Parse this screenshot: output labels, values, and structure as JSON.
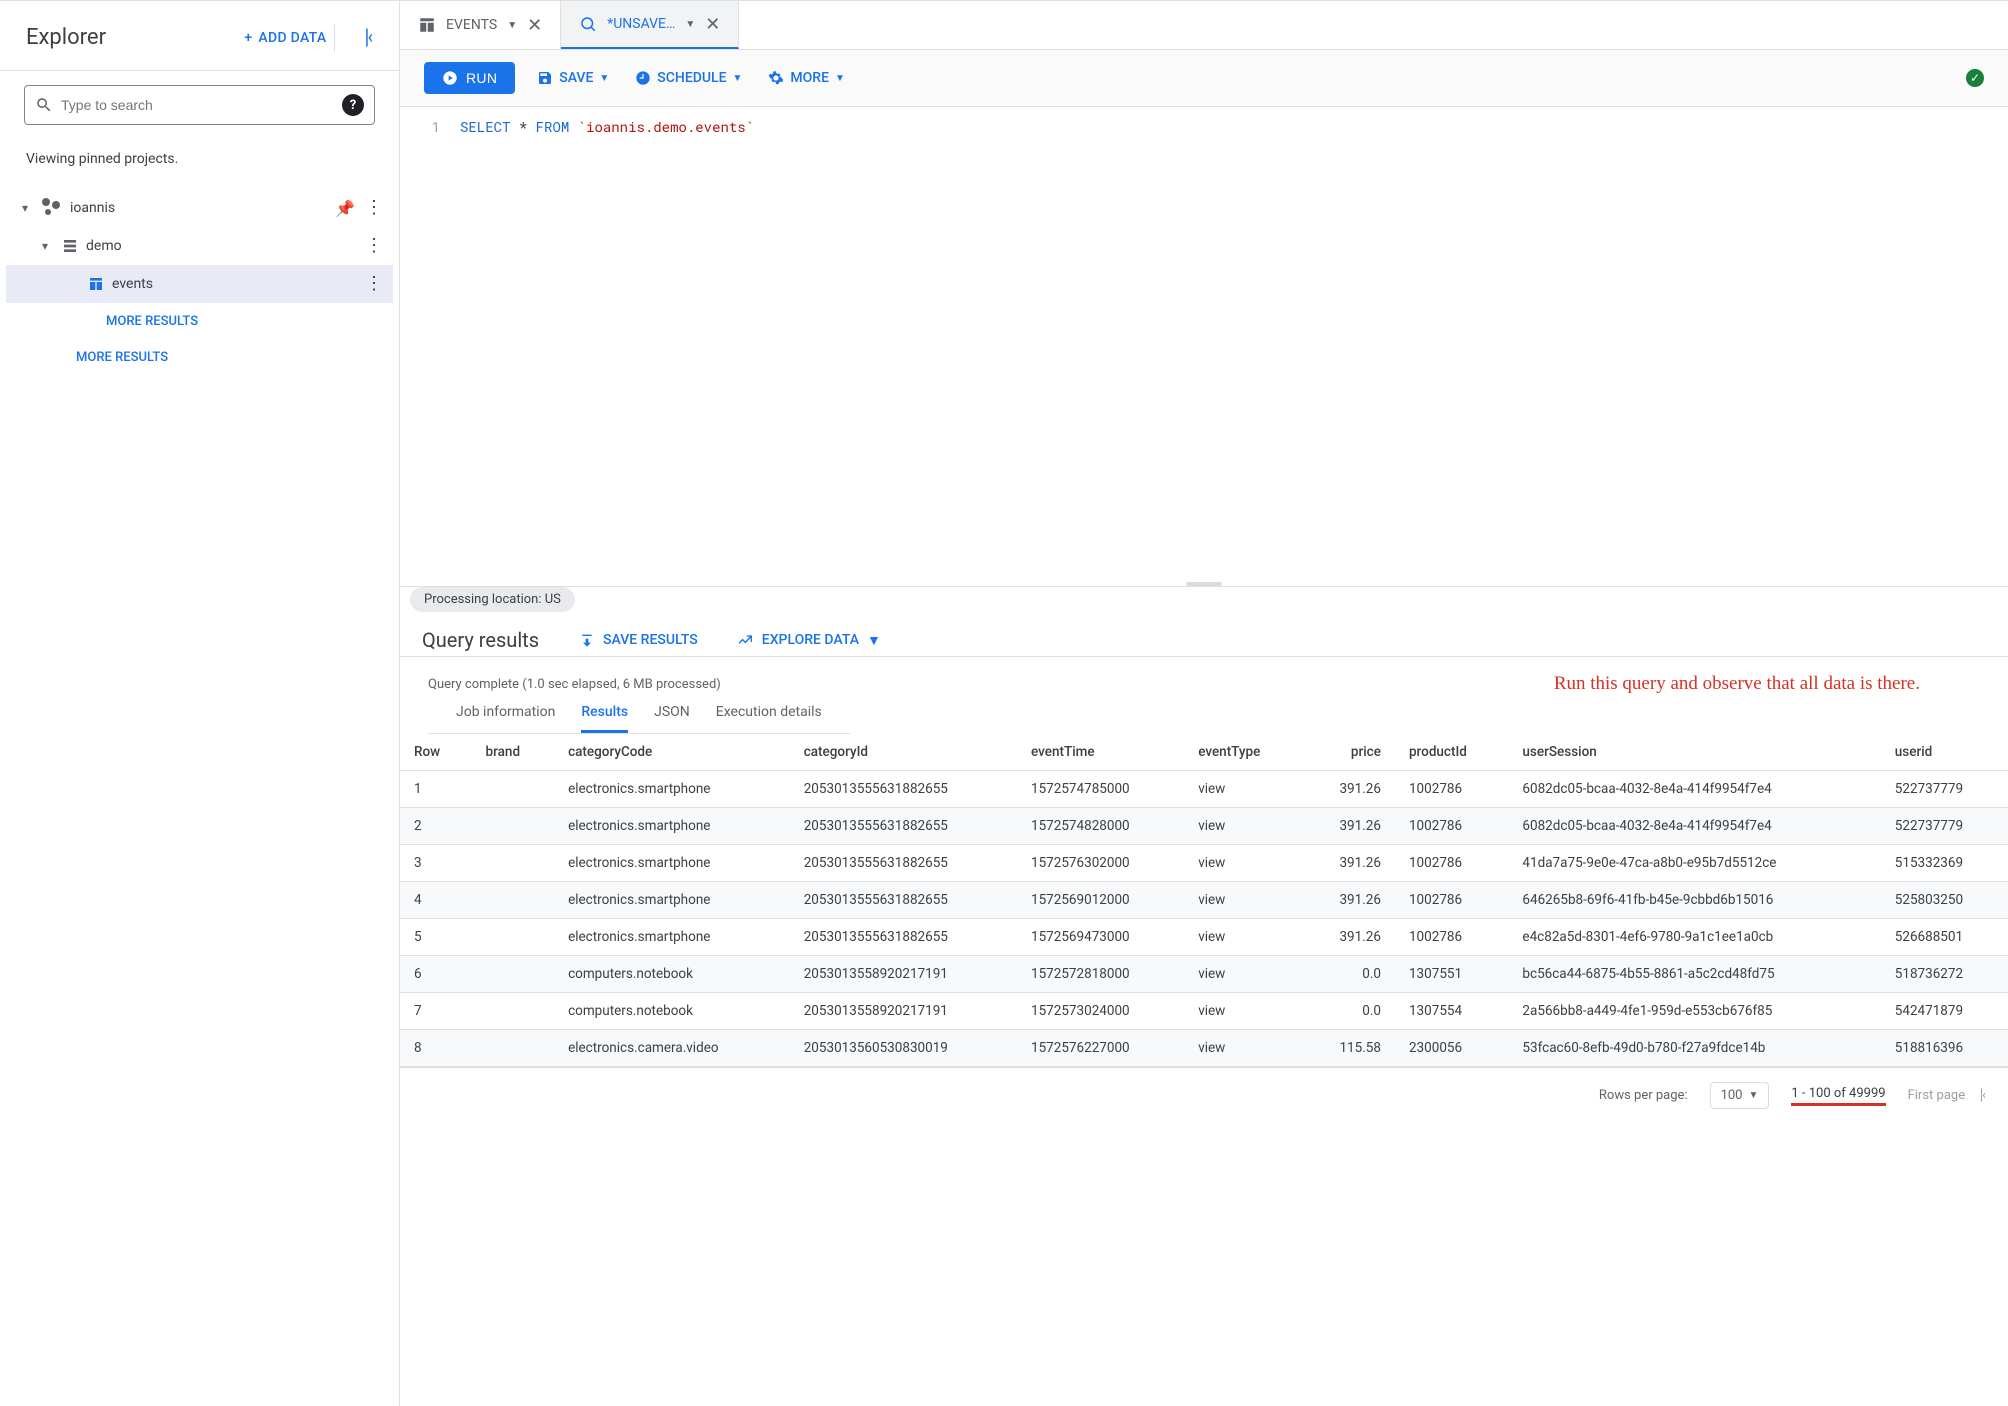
{
  "sidebar": {
    "title": "Explorer",
    "add_data": "ADD DATA",
    "search_placeholder": "Type to search",
    "viewing": "Viewing pinned projects.",
    "project": "ioannis",
    "dataset": "demo",
    "table": "events",
    "more_results": "MORE RESULTS",
    "more_results_outer": "MORE RESULTS"
  },
  "tabs": {
    "t0": "EVENTS",
    "t1": "*UNSAVE…"
  },
  "toolbar": {
    "run": "RUN",
    "save": "SAVE",
    "schedule": "SCHEDULE",
    "more": "MORE"
  },
  "editor": {
    "line_no": "1",
    "kw_select": "SELECT",
    "star": " * ",
    "kw_from": "FROM",
    "space": " ",
    "table_ref": "`ioannis.demo.events`"
  },
  "results": {
    "chip": "Processing location: US",
    "title": "Query results",
    "save_results": "SAVE RESULTS",
    "explore_data": "EXPLORE DATA",
    "complete": "Query complete (1.0 sec elapsed, 6 MB processed)",
    "tabs": {
      "job": "Job information",
      "results": "Results",
      "json": "JSON",
      "exec": "Execution details"
    }
  },
  "annotation": "Run this query and observe that all data is there.",
  "columns": {
    "row": "Row",
    "brand": "brand",
    "categoryCode": "categoryCode",
    "categoryId": "categoryId",
    "eventTime": "eventTime",
    "eventType": "eventType",
    "price": "price",
    "productId": "productId",
    "userSession": "userSession",
    "userid": "userid"
  },
  "rows": [
    {
      "n": "1",
      "brand": "",
      "cc": "electronics.smartphone",
      "cid": "2053013555631882655",
      "et": "1572574785000",
      "ety": "view",
      "price": "391.26",
      "pid": "1002786",
      "sess": "6082dc05-bcaa-4032-8e4a-414f9954f7e4",
      "uid": "522737779"
    },
    {
      "n": "2",
      "brand": "",
      "cc": "electronics.smartphone",
      "cid": "2053013555631882655",
      "et": "1572574828000",
      "ety": "view",
      "price": "391.26",
      "pid": "1002786",
      "sess": "6082dc05-bcaa-4032-8e4a-414f9954f7e4",
      "uid": "522737779"
    },
    {
      "n": "3",
      "brand": "",
      "cc": "electronics.smartphone",
      "cid": "2053013555631882655",
      "et": "1572576302000",
      "ety": "view",
      "price": "391.26",
      "pid": "1002786",
      "sess": "41da7a75-9e0e-47ca-a8b0-e95b7d5512ce",
      "uid": "515332369"
    },
    {
      "n": "4",
      "brand": "",
      "cc": "electronics.smartphone",
      "cid": "2053013555631882655",
      "et": "1572569012000",
      "ety": "view",
      "price": "391.26",
      "pid": "1002786",
      "sess": "646265b8-69f6-41fb-b45e-9cbbd6b15016",
      "uid": "525803250"
    },
    {
      "n": "5",
      "brand": "",
      "cc": "electronics.smartphone",
      "cid": "2053013555631882655",
      "et": "1572569473000",
      "ety": "view",
      "price": "391.26",
      "pid": "1002786",
      "sess": "e4c82a5d-8301-4ef6-9780-9a1c1ee1a0cb",
      "uid": "526688501"
    },
    {
      "n": "6",
      "brand": "",
      "cc": "computers.notebook",
      "cid": "2053013558920217191",
      "et": "1572572818000",
      "ety": "view",
      "price": "0.0",
      "pid": "1307551",
      "sess": "bc56ca44-6875-4b55-8861-a5c2cd48fd75",
      "uid": "518736272"
    },
    {
      "n": "7",
      "brand": "",
      "cc": "computers.notebook",
      "cid": "2053013558920217191",
      "et": "1572573024000",
      "ety": "view",
      "price": "0.0",
      "pid": "1307554",
      "sess": "2a566bb8-a449-4fe1-959d-e553cb676f85",
      "uid": "542471879"
    },
    {
      "n": "8",
      "brand": "",
      "cc": "electronics.camera.video",
      "cid": "2053013560530830019",
      "et": "1572576227000",
      "ety": "view",
      "price": "115.58",
      "pid": "2300056",
      "sess": "53fcac60-8efb-49d0-b780-f27a9fdce14b",
      "uid": "518816396"
    }
  ],
  "pager": {
    "rows_per_page": "Rows per page:",
    "page_size": "100",
    "range": "1 - 100 of 49999",
    "first": "First page"
  }
}
